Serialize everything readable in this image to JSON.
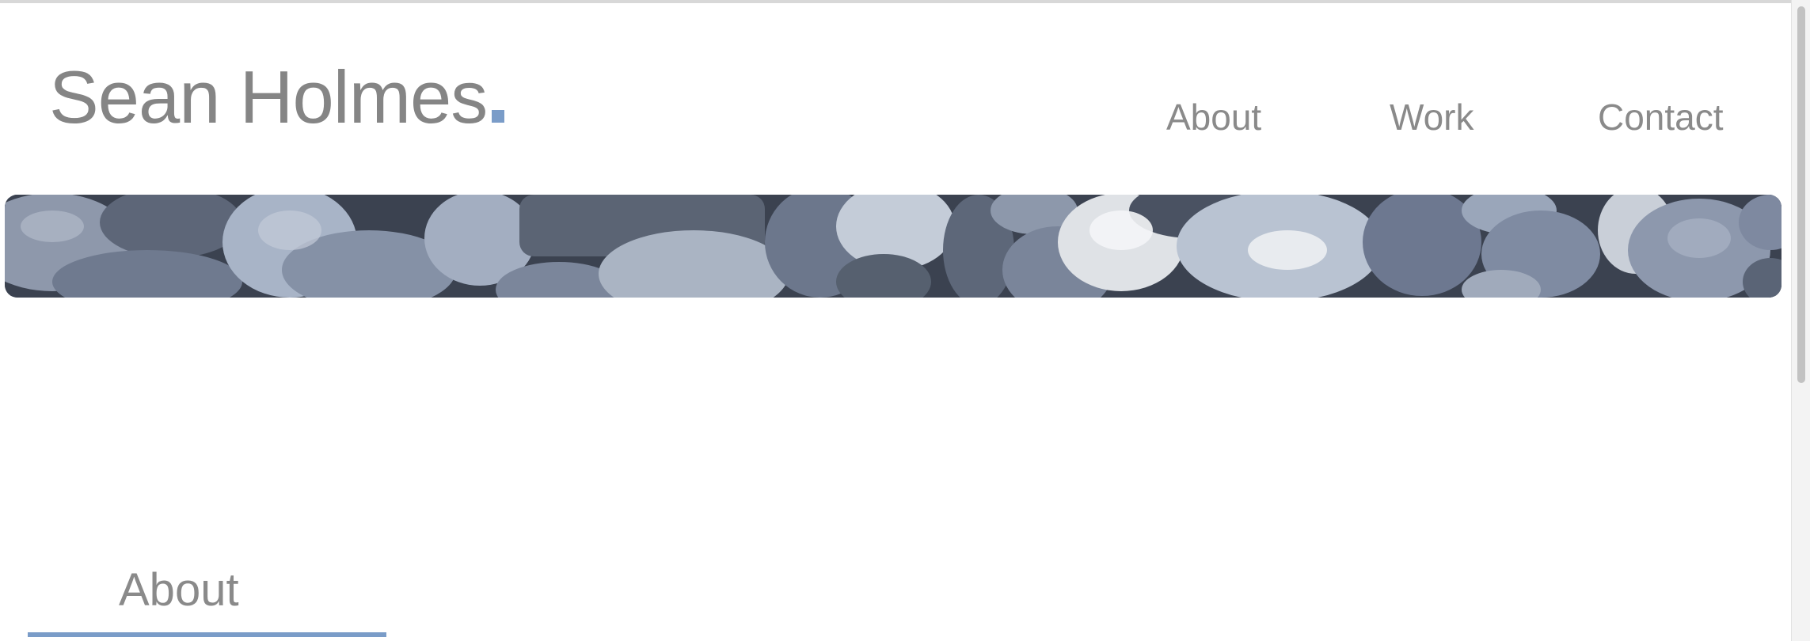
{
  "header": {
    "logo_text": "Sean Holmes",
    "logo_dot": "."
  },
  "nav": {
    "items": [
      {
        "label": "About"
      },
      {
        "label": "Work"
      },
      {
        "label": "Contact"
      }
    ]
  },
  "banner": {
    "description_icon": "pebbles-banner-image"
  },
  "main": {
    "section_title": "About"
  },
  "colors": {
    "accent": "#7a9cc8",
    "text_gray": "#8a8a8a",
    "background": "#ffffff"
  }
}
